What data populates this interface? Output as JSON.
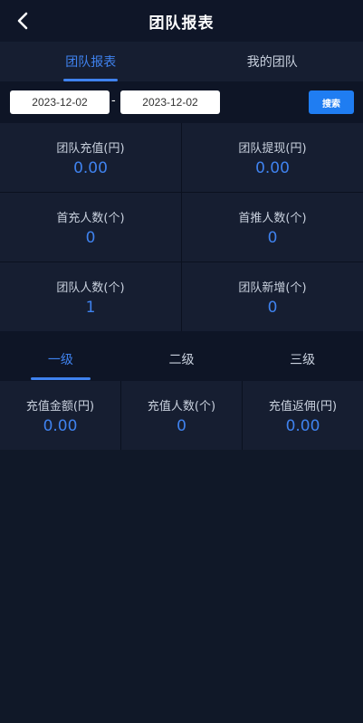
{
  "header": {
    "title": "团队报表",
    "back_icon": "chevron-left-icon"
  },
  "main_tabs": [
    {
      "label": "团队报表",
      "active": true
    },
    {
      "label": "我的团队",
      "active": false
    }
  ],
  "filter": {
    "start_date": "2023-12-02",
    "separator": "-",
    "end_date": "2023-12-02",
    "search_label": "搜索"
  },
  "stats": [
    {
      "label": "团队充值(円)",
      "value": "0.00"
    },
    {
      "label": "团队提现(円)",
      "value": "0.00"
    },
    {
      "label": "首充人数(个)",
      "value": "0"
    },
    {
      "label": "首推人数(个)",
      "value": "0"
    },
    {
      "label": "团队人数(个)",
      "value": "1"
    },
    {
      "label": "团队新增(个)",
      "value": "0"
    }
  ],
  "level_tabs": [
    {
      "label": "一级",
      "active": true
    },
    {
      "label": "二级",
      "active": false
    },
    {
      "label": "三级",
      "active": false
    }
  ],
  "level_stats": [
    {
      "label": "充值金额(円)",
      "value": "0.00"
    },
    {
      "label": "充值人数(个)",
      "value": "0"
    },
    {
      "label": "充值返佣(円)",
      "value": "0.00"
    }
  ],
  "colors": {
    "accent": "#3f82ee",
    "button": "#1f7df2",
    "background": "#0e1526",
    "card": "#161e31"
  }
}
